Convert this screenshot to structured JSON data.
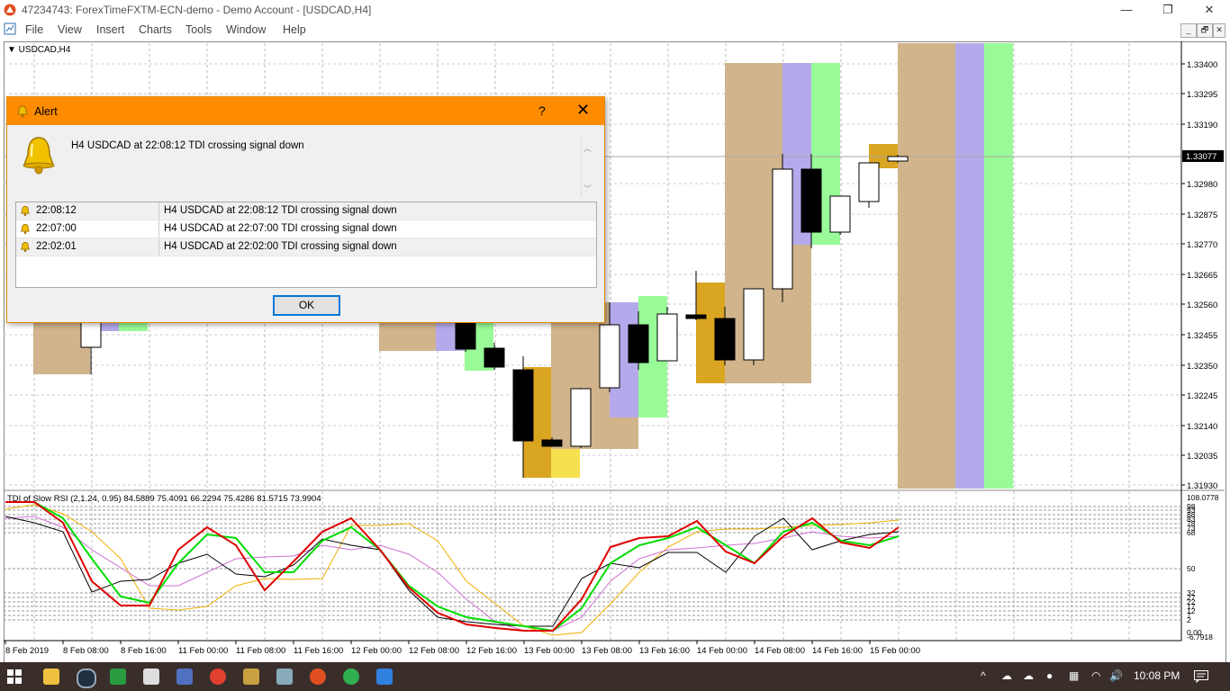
{
  "window": {
    "title": "47234743: ForexTimeFXTM-ECN-demo - Demo Account - [USDCAD,H4]",
    "minimize": "—",
    "restore": "❐",
    "close": "✕"
  },
  "menu": {
    "items": [
      "File",
      "View",
      "Insert",
      "Charts",
      "Tools",
      "Window",
      "Help"
    ]
  },
  "mdi_buttons": [
    "_",
    "🗗",
    "✕"
  ],
  "chart": {
    "symbol_label": "▼ USDCAD,H4",
    "price_labels": [
      "1.33400",
      "1.33295",
      "1.33190",
      "1.33077",
      "1.32980",
      "1.32875",
      "1.32770",
      "1.32665",
      "1.32560",
      "1.32455",
      "1.32350",
      "1.32245",
      "1.32140",
      "1.32035",
      "1.31930"
    ],
    "current_price": "1.33077",
    "indicator_label": "TDI of Slow RSI  (2,1.24, 0.95) 84.5889 75.4091 66.2294 75.4286 81.5715 73.9904",
    "indicator_levels": [
      "108.0778",
      "98",
      "93",
      "88",
      "83",
      "78",
      "73",
      "68",
      "50",
      "32",
      "27",
      "22",
      "17",
      "12",
      "7",
      "2",
      "0.00",
      "-6.7918"
    ],
    "time_labels": [
      "8 Feb 2019",
      "8 Feb 08:00",
      "8 Feb 16:00",
      "11 Feb 00:00",
      "11 Feb 08:00",
      "11 Feb 16:00",
      "12 Feb 00:00",
      "12 Feb 08:00",
      "12 Feb 16:00",
      "13 Feb 00:00",
      "13 Feb 08:00",
      "13 Feb 16:00",
      "14 Feb 00:00",
      "14 Feb 08:00",
      "14 Feb 16:00",
      "15 Feb 00:00"
    ],
    "colors": {
      "tan": "#d2b48c",
      "lavender": "#b4aaeb",
      "light_green": "#98fb98",
      "goldenrod": "#daa520",
      "yellow": "#f5e050",
      "rsi_red": "#e00000",
      "rsi_green": "#00dd00",
      "yellow_line": "#f0b000",
      "violet_line": "#d070d0",
      "black_line": "#000000"
    }
  },
  "alert": {
    "title": "Alert",
    "help": "?",
    "close": "✕",
    "message": "H4 USDCAD at 22:08:12 TDI crossing signal down",
    "rows": [
      {
        "time": "22:08:12",
        "message": "H4 USDCAD at 22:08:12 TDI crossing signal down"
      },
      {
        "time": "22:07:00",
        "message": "H4 USDCAD at 22:07:00 TDI crossing signal down"
      },
      {
        "time": "22:02:01",
        "message": "H4 USDCAD at 22:02:00 TDI crossing signal down"
      }
    ],
    "ok_label": "OK"
  },
  "taskbar": {
    "clock": "10:08 PM",
    "tray_caret": "^"
  }
}
